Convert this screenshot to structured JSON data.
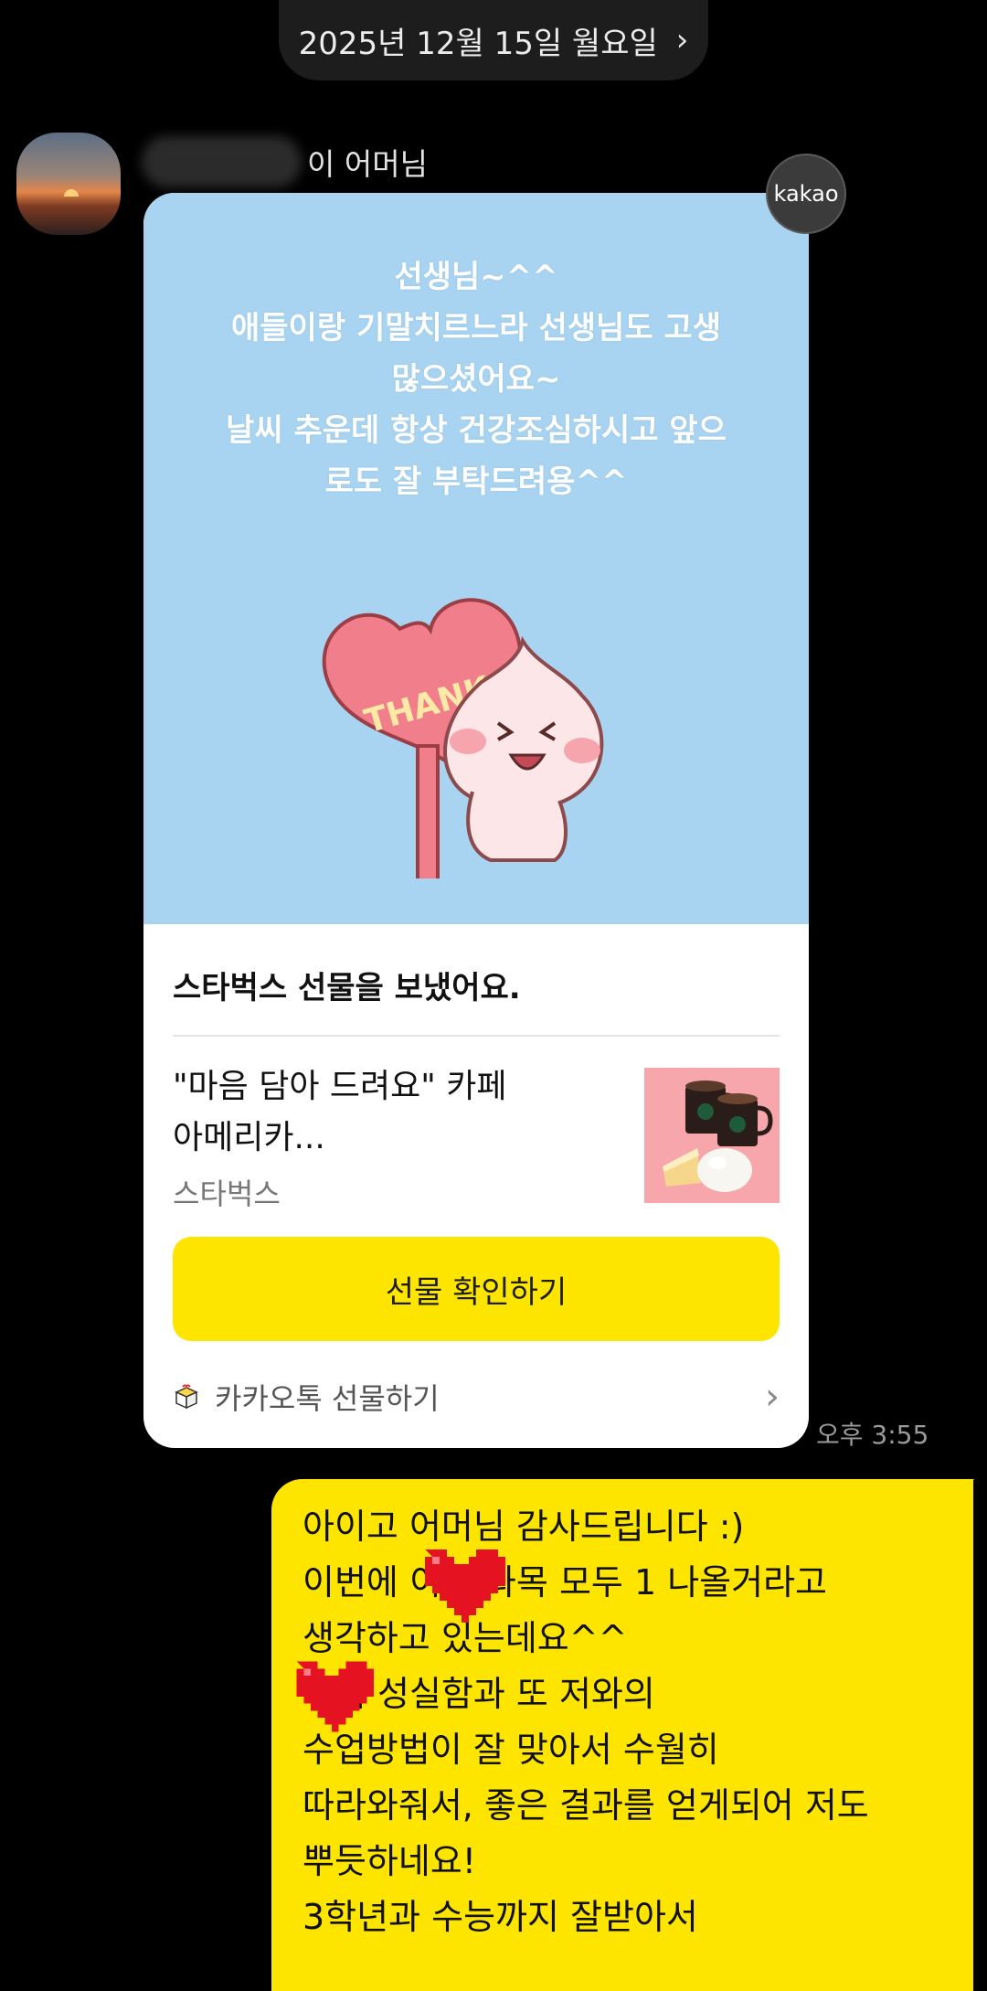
{
  "date_header": {
    "label": "2025년 12월 15일 월요일",
    "chevron_icon": "chevron-right-icon"
  },
  "incoming": {
    "sender_suffix": "이 어머님",
    "badge": "kakao",
    "card": {
      "message_lines": [
        "선생님~^^",
        "애들이랑 기말치르느라 선생님도 고생",
        "많으셨어요~",
        "날씨 추운데  항상 건강조심하시고 앞으",
        "로도 잘 부탁드려용^^"
      ],
      "sticker_text": "THANKS",
      "title": "스타벅스 선물을 보냈어요.",
      "product_name_line1": "\"마음 담아 드려요\" 카페",
      "product_name_line2": "아메리카...",
      "product_brand": "스타벅스",
      "button_label": "선물 확인하기",
      "footer_label": "카카오톡 선물하기",
      "top_color": "#a8d4f1",
      "button_color": "#fee500"
    },
    "time": "오후 3:55"
  },
  "outgoing": {
    "lines": [
      "아이고 어머님 감사드립니다 :)",
      "이번에       이 두과목 모두 1 나올거라고",
      "생각하고 있는데요^^",
      "      이의 성실함과 또 저와의",
      "수업방법이 잘 맞아서 수월히",
      "따라와줘서, 좋은 결과를 얻게되어 저도",
      "뿌듯하네요!",
      "3학년과 수능까지 잘받아서"
    ],
    "bubble_color": "#fee500"
  }
}
